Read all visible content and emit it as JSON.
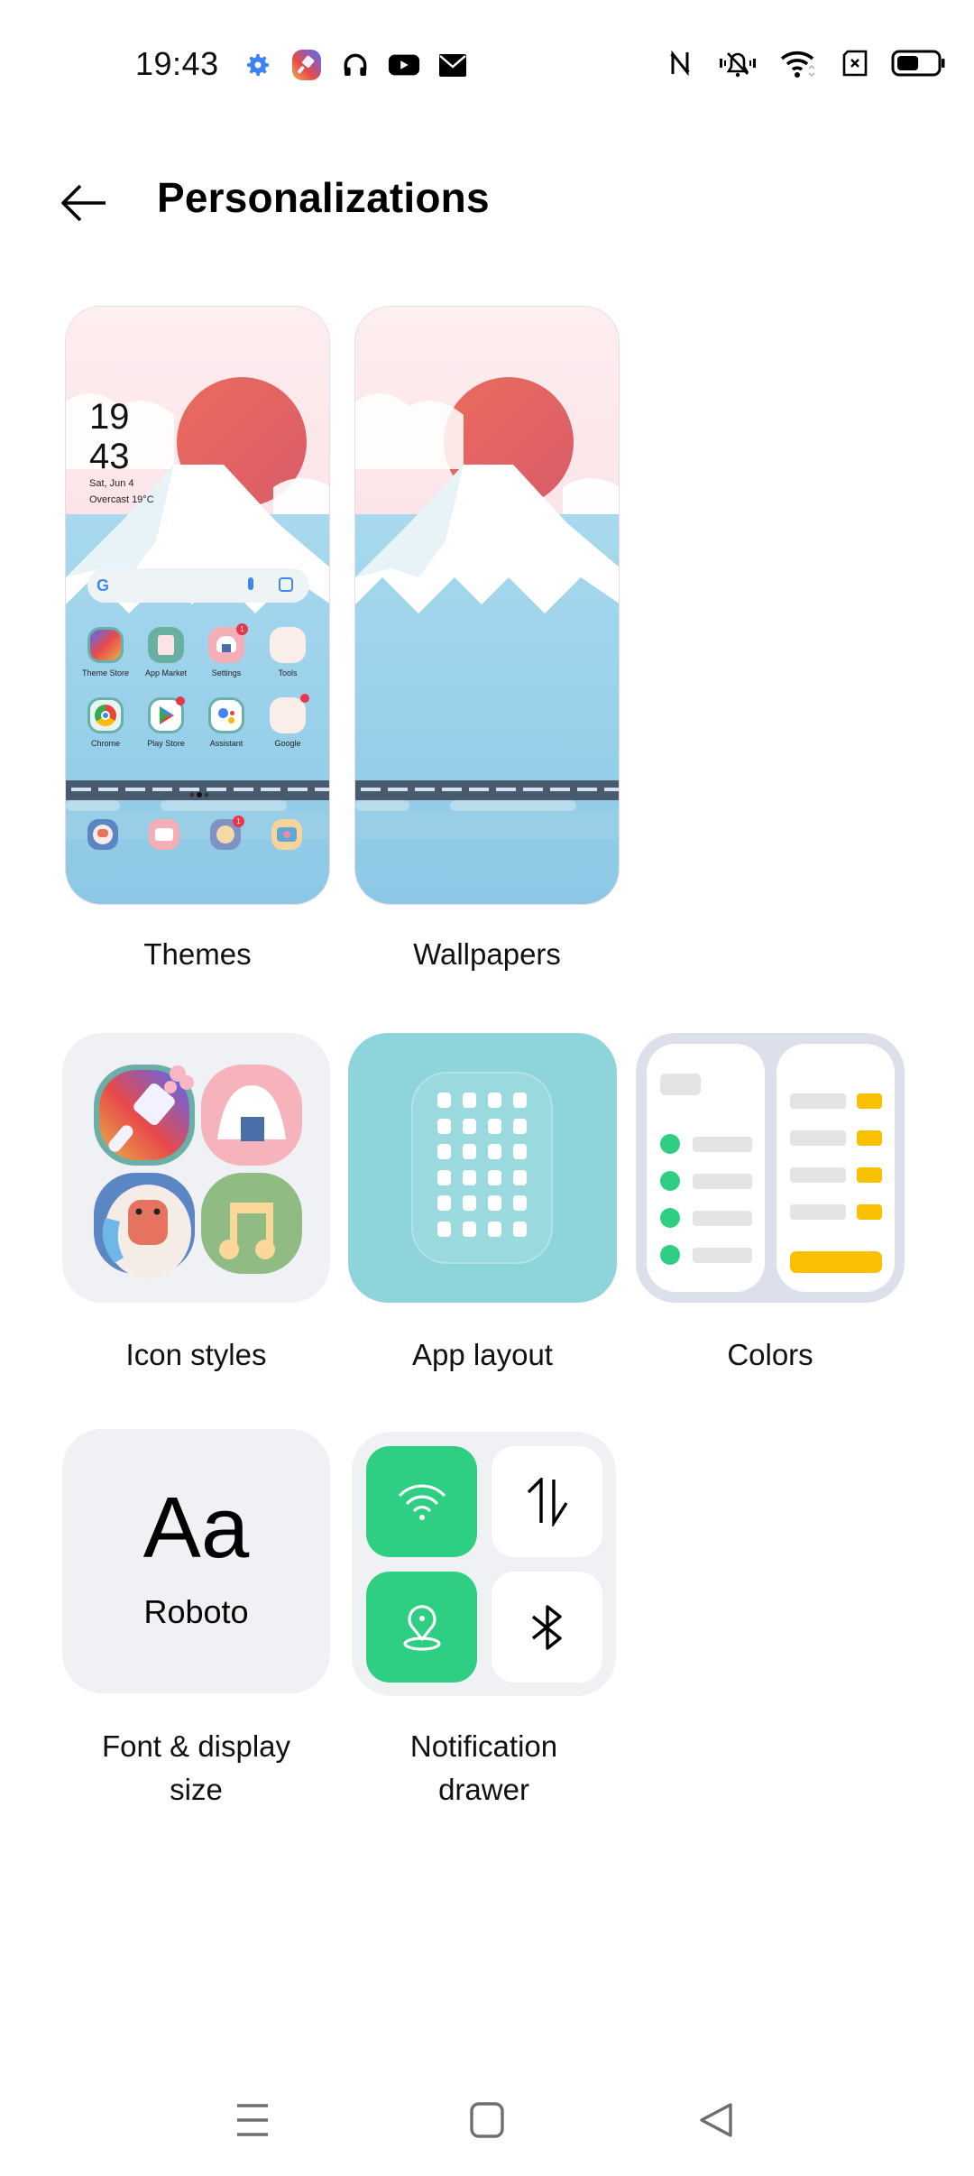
{
  "status_bar": {
    "time": "19:43",
    "left_icons": [
      "settings-gear-icon",
      "theme-store-icon",
      "headphones-icon",
      "youtube-icon",
      "mail-icon"
    ],
    "right_icons": [
      "nfc-icon",
      "vibrate-muted-bell-icon",
      "wifi-icon",
      "no-sim-icon",
      "battery-icon"
    ],
    "battery_percent": 55,
    "colors": {
      "gear": "#3b82f6"
    }
  },
  "header": {
    "back_label": "Back",
    "title": "Personalizations"
  },
  "theme_preview": {
    "clock_hour": "19",
    "clock_minute": "43",
    "date": "Sat, Jun 4",
    "weather": "Overcast 19°C",
    "apps_row1": [
      {
        "label": "Theme Store",
        "badge": ""
      },
      {
        "label": "App Market",
        "badge": ""
      },
      {
        "label": "Settings",
        "badge": "1"
      },
      {
        "label": "Tools",
        "badge": ""
      }
    ],
    "apps_row2": [
      {
        "label": "Chrome",
        "badge": ""
      },
      {
        "label": "Play Store",
        "badge": "dot"
      },
      {
        "label": "Assistant",
        "badge": ""
      },
      {
        "label": "Google",
        "badge": "dot"
      }
    ],
    "dock_badge": "1"
  },
  "tiles": {
    "themes": "Themes",
    "wallpapers": "Wallpapers",
    "icon_styles": "Icon styles",
    "app_layout": "App layout",
    "colors": "Colors",
    "font_line1": "Font & display",
    "font_line2": "size",
    "font_sample": "Aa",
    "font_name": "Roboto",
    "notif_line1": "Notification",
    "notif_line2": "drawer"
  },
  "colors": {
    "accent_green": "#2ecf83",
    "accent_yellow": "#f8c000",
    "tile_bg": "#f0f1f5",
    "app_layout_bg": "#8dd5da",
    "colors_frame": "#dbe0eb"
  },
  "navbar": {
    "items": [
      "recents-menu",
      "home",
      "back"
    ]
  }
}
